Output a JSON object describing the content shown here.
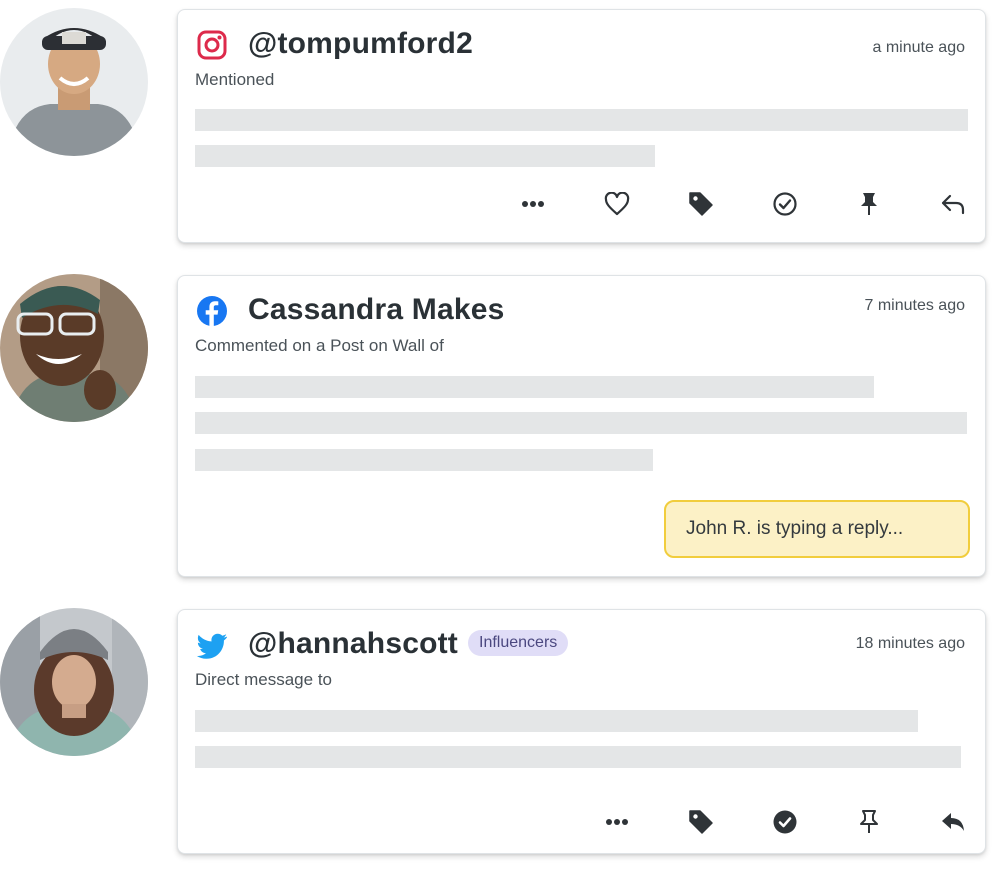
{
  "posts": [
    {
      "network": "Instagram",
      "network_icon": "instagram-icon",
      "author": "@tompumford2",
      "time": "a minute ago",
      "subtitle": "Mentioned",
      "actions": [
        "more-icon",
        "heart-icon",
        "tag-icon",
        "check-circle-icon",
        "pin-icon",
        "reply-icon"
      ]
    },
    {
      "network": "Facebook",
      "network_icon": "facebook-icon",
      "author": "Cassandra Makes",
      "time": "7 minutes ago",
      "subtitle": "Commented on a Post on Wall of",
      "typing_indicator": "John R. is typing a reply..."
    },
    {
      "network": "Twitter",
      "network_icon": "twitter-icon",
      "author": "@hannahscott",
      "badge": "Influencers",
      "time": "18 minutes ago",
      "subtitle": "Direct message to",
      "actions": [
        "more-icon",
        "tag-icon",
        "check-circle-filled-icon",
        "pin-outline-icon",
        "reply-icon"
      ]
    }
  ],
  "colors": {
    "instagram": "#dd2a4b",
    "facebook": "#1877f2",
    "twitter": "#1da1f2",
    "placeholder_bar": "#e4e6e7",
    "typing_bg": "#fcf1c6",
    "typing_border": "#f1cd3d",
    "badge_bg": "#e0ddf7"
  }
}
